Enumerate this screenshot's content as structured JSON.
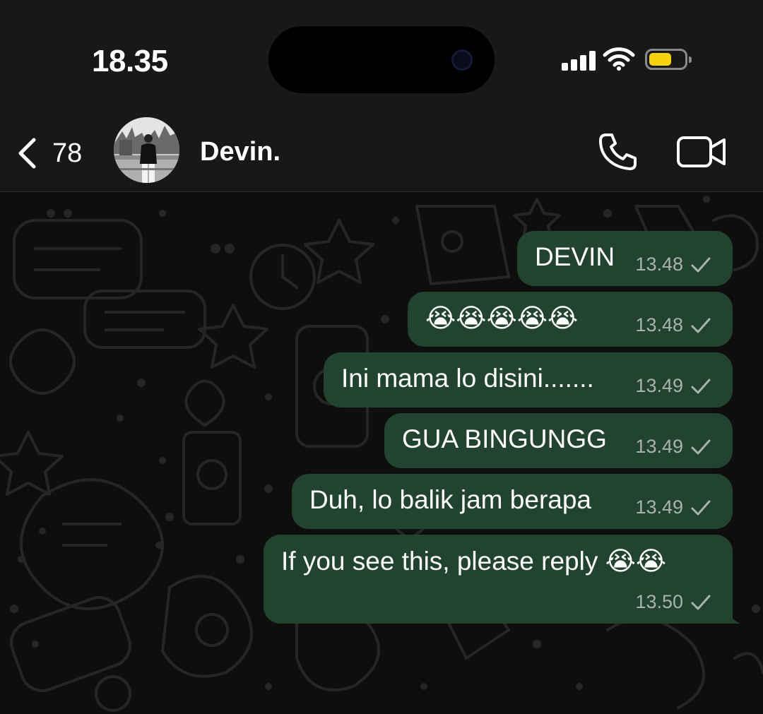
{
  "status_bar": {
    "time": "18.35",
    "icons": [
      "cellular-signal-icon",
      "wifi-icon",
      "battery-icon"
    ],
    "battery_color": "#f5d20a"
  },
  "header": {
    "back_count": "78",
    "contact_name": "Devin.",
    "icons": [
      "chevron-left-icon",
      "phone-icon",
      "video-camera-icon"
    ]
  },
  "colors": {
    "outgoing_bubble": "#22432f",
    "chat_background": "#0e0e0e",
    "header_background": "#181818"
  },
  "messages": [
    {
      "text": "DEVIN",
      "time": "13.48",
      "status": "sent"
    },
    {
      "text": "😭😭😭😭😭",
      "time": "13.48",
      "status": "sent"
    },
    {
      "text": "Ini mama lo disini.......",
      "time": "13.49",
      "status": "sent"
    },
    {
      "text": "GUA BINGUNGG",
      "time": "13.49",
      "status": "sent"
    },
    {
      "text": "Duh, lo balik jam berapa",
      "time": "13.49",
      "status": "sent"
    },
    {
      "text": "If you see this, please reply 😭😭",
      "time": "13.50",
      "status": "sent"
    }
  ]
}
